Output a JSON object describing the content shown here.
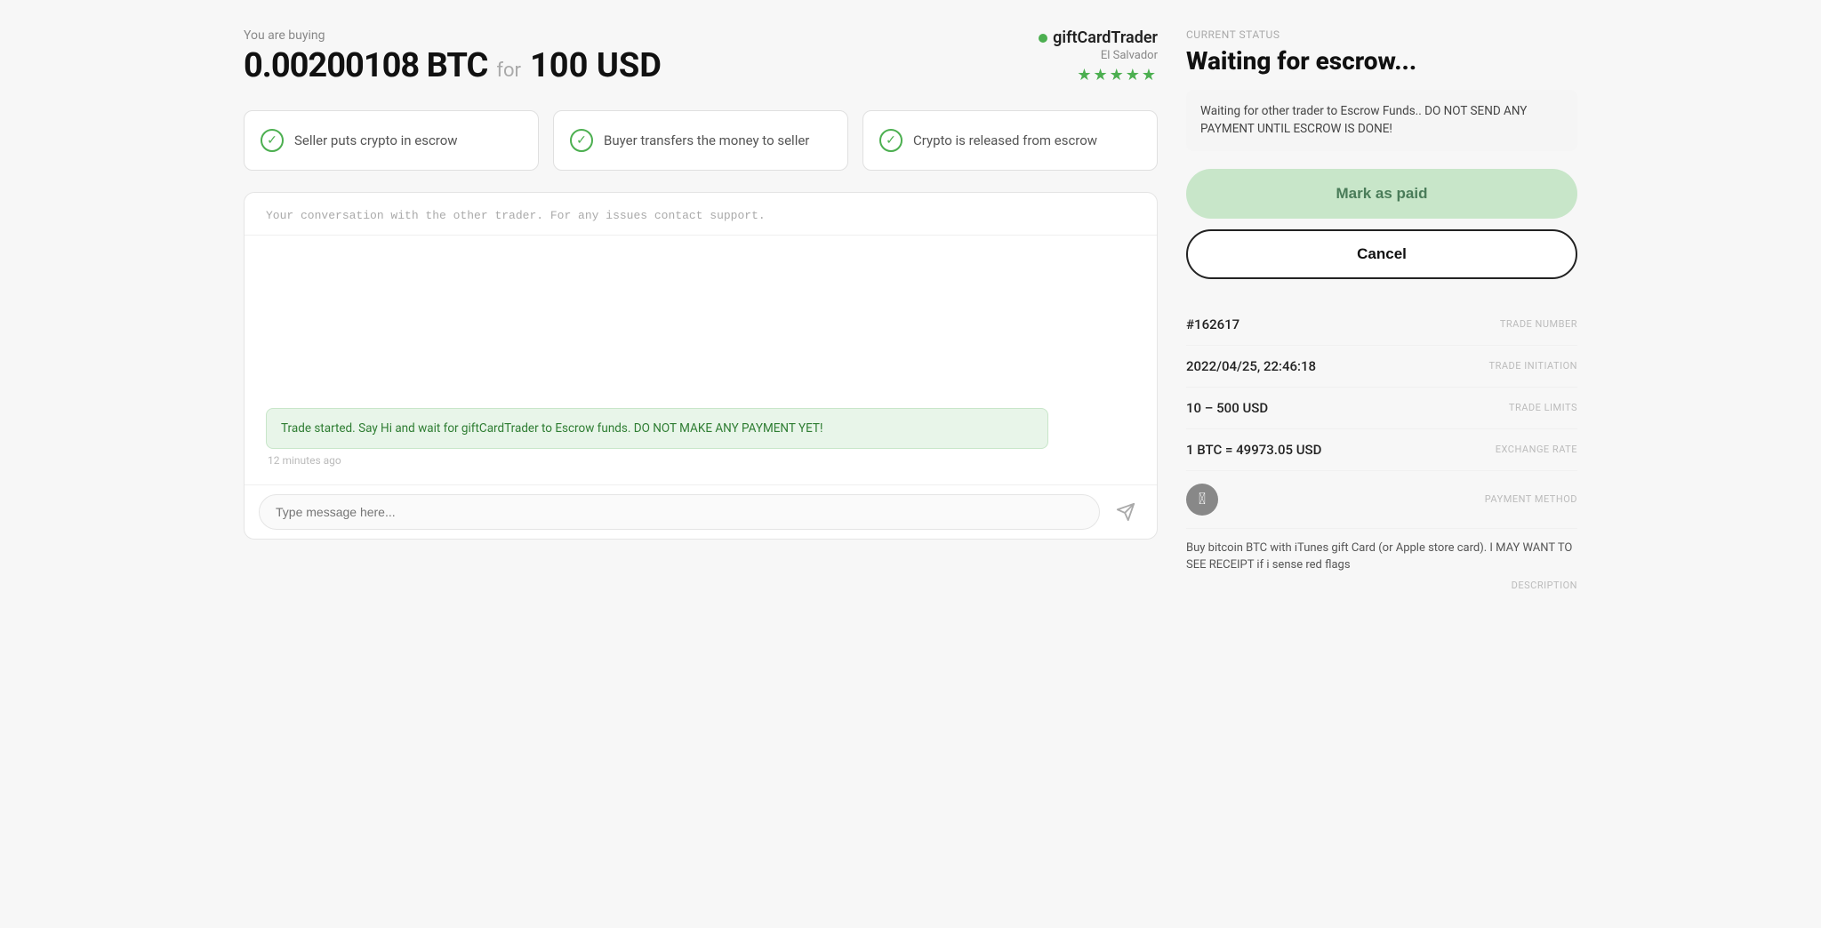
{
  "header": {
    "you_are_buying": "You are buying",
    "btc_amount": "0.00200108 BTC",
    "for_text": "for",
    "usd_amount": "100 USD",
    "trader_name": "giftCardTrader",
    "trader_location": "El Salvador",
    "stars": "★★★★★"
  },
  "steps": [
    {
      "label": "Seller puts crypto in escrow",
      "active": true
    },
    {
      "label": "Buyer transfers the money to seller",
      "active": true
    },
    {
      "label": "Crypto is released from escrow",
      "active": true
    }
  ],
  "chat": {
    "header_note": "Your conversation with the other trader. For any issues contact support.",
    "message": "Trade started. Say Hi and wait for giftCardTrader to Escrow funds. DO NOT MAKE ANY PAYMENT YET!",
    "timestamp": "12 minutes ago",
    "input_placeholder": "Type message here..."
  },
  "status_panel": {
    "current_status_label": "CURRENT STATUS",
    "status_title": "Waiting for escrow...",
    "warning_text": "Waiting for other trader to Escrow Funds.. DO NOT SEND ANY PAYMENT UNTIL ESCROW IS DONE!",
    "mark_paid_label": "Mark as paid",
    "cancel_label": "Cancel",
    "trade_number_value": "#162617",
    "trade_number_label": "TRADE NUMBER",
    "trade_initiation_value": "2022/04/25, 22:46:18",
    "trade_initiation_label": "TRADE INITIATION",
    "trade_limits_value": "10 – 500 USD",
    "trade_limits_label": "TRADE LIMITS",
    "exchange_rate_value": "1 BTC = 49973.05 USD",
    "exchange_rate_label": "EXCHANGE RATE",
    "payment_method_label": "PAYMENT METHOD",
    "description_text": "Buy bitcoin BTC with iTunes gift Card (or Apple store card). I MAY WANT TO SEE RECEIPT if i sense red flags",
    "description_label": "DESCRIPTION"
  }
}
